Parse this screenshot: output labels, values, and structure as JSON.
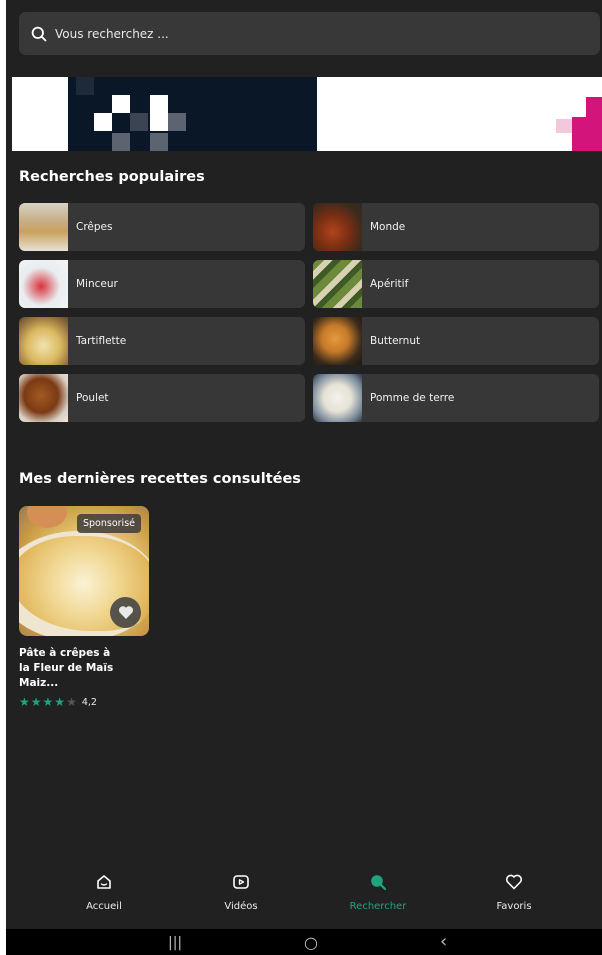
{
  "search": {
    "placeholder": "Vous recherchez ..."
  },
  "popular": {
    "title": "Recherches populaires",
    "items": [
      {
        "label": "Crêpes"
      },
      {
        "label": "Monde"
      },
      {
        "label": "Minceur"
      },
      {
        "label": "Apéritif"
      },
      {
        "label": "Tartiflette"
      },
      {
        "label": "Butternut"
      },
      {
        "label": "Poulet"
      },
      {
        "label": "Pomme de terre"
      }
    ]
  },
  "recent": {
    "title": "Mes dernières recettes consultées",
    "card": {
      "badge": "Sponsorisé",
      "title_line1": "Pâte à crêpes à",
      "title_line2": "la Fleur de Maïs Maiz...",
      "rating": "4,2",
      "stars_filled": 4,
      "stars_total": 5
    }
  },
  "nav": {
    "items": [
      {
        "label": "Accueil",
        "icon": "home-icon"
      },
      {
        "label": "Vidéos",
        "icon": "video-icon"
      },
      {
        "label": "Rechercher",
        "icon": "search-icon"
      },
      {
        "label": "Favoris",
        "icon": "heart-icon"
      }
    ],
    "active": "Rechercher"
  },
  "system_nav": {
    "recent": "|||",
    "home": "○",
    "back": "‹"
  },
  "colors": {
    "accent": "#1ea57f",
    "background": "#212121",
    "card": "#373737"
  }
}
